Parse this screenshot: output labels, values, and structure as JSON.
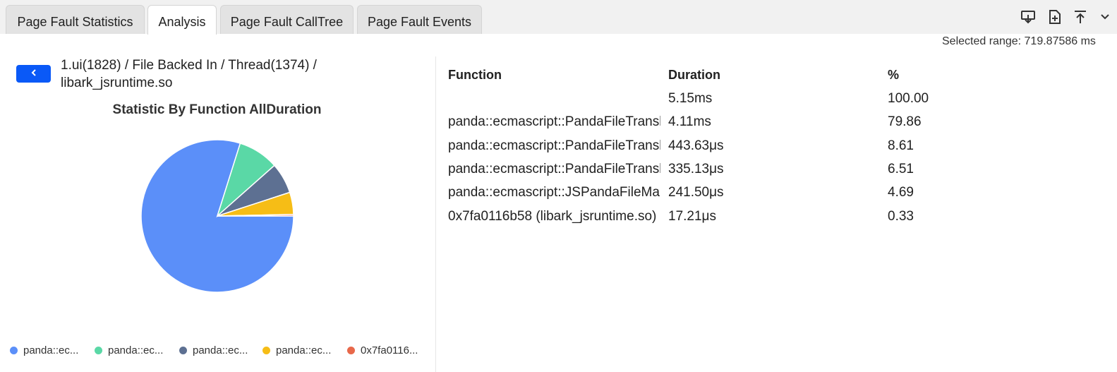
{
  "tabs": [
    {
      "label": "Page Fault Statistics",
      "active": false
    },
    {
      "label": "Analysis",
      "active": true
    },
    {
      "label": "Page Fault CallTree",
      "active": false
    },
    {
      "label": "Page Fault Events",
      "active": false
    }
  ],
  "toolbar": {
    "icons": [
      "download-icon",
      "file-add-icon",
      "upload-icon",
      "chevron-down-icon"
    ]
  },
  "selected_range": "Selected range: 719.87586 ms",
  "breadcrumb": "1.ui(1828) / File Backed In / Thread(1374) / libark_jsruntime.so",
  "table": {
    "headers": [
      "Function",
      "Duration",
      "%"
    ],
    "rows": [
      {
        "function": "",
        "duration": "5.15ms",
        "percent": "100.00"
      },
      {
        "function": "panda::ecmascript::PandaFileTranslator",
        "duration": "4.11ms",
        "percent": "79.86"
      },
      {
        "function": "panda::ecmascript::PandaFileTranslator",
        "duration": "443.63μs",
        "percent": "8.61"
      },
      {
        "function": "panda::ecmascript::PandaFileTranslator",
        "duration": "335.13μs",
        "percent": "6.51"
      },
      {
        "function": "panda::ecmascript::JSPandaFileManager",
        "duration": "241.50μs",
        "percent": "4.69"
      },
      {
        "function": "0x7fa0116b58 (libark_jsruntime.so)",
        "duration": "17.21μs",
        "percent": "0.33"
      }
    ]
  },
  "colors": {
    "accent": "#0a59f7",
    "slices": [
      "#5b8ff9",
      "#5ad8a6",
      "#5d7092",
      "#f6bd16",
      "#e8684a"
    ]
  },
  "chart_data": {
    "type": "pie",
    "title": "Statistic By Function AllDuration",
    "categories": [
      "panda::ec...",
      "panda::ec...",
      "panda::ec...",
      "panda::ec...",
      "0x7fa0116..."
    ],
    "values": [
      79.86,
      8.61,
      6.51,
      4.69,
      0.33
    ],
    "legend": "bottom"
  }
}
